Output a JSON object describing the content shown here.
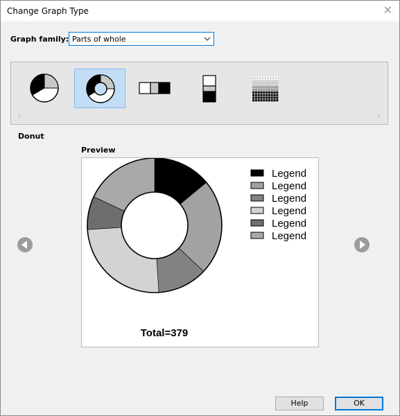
{
  "window": {
    "title": "Change Graph Type",
    "close_icon": "close-icon"
  },
  "graph_family": {
    "label": "Graph family:",
    "selected": "Parts of whole"
  },
  "gallery": {
    "items": [
      {
        "name": "pie",
        "icon": "pie-chart-icon",
        "selected": false
      },
      {
        "name": "donut",
        "icon": "donut-chart-icon",
        "selected": true
      },
      {
        "name": "stacked-bar",
        "icon": "stacked-bar-icon",
        "selected": false
      },
      {
        "name": "stacked-column",
        "icon": "stacked-column-icon",
        "selected": false
      },
      {
        "name": "waffle",
        "icon": "waffle-chart-icon",
        "selected": false
      }
    ],
    "scroll_left_icon": "chevron-left-icon",
    "scroll_right_icon": "chevron-right-icon"
  },
  "selected_type_name": "Donut",
  "preview": {
    "label": "Preview",
    "chart_data": {
      "type": "pie",
      "variant": "donut",
      "series": [
        {
          "name": "Legend",
          "value": 14,
          "color": "#000000"
        },
        {
          "name": "Legend",
          "value": 23,
          "color": "#a2a2a2"
        },
        {
          "name": "Legend",
          "value": 12,
          "color": "#828282"
        },
        {
          "name": "Legend",
          "value": 25,
          "color": "#d3d3d3"
        },
        {
          "name": "Legend",
          "value": 8,
          "color": "#6e6e6e"
        },
        {
          "name": "Legend",
          "value": 18,
          "color": "#a9a9a9"
        }
      ],
      "total_label": "Total=379",
      "legend_position": "top-right"
    }
  },
  "navigation": {
    "prev_icon": "arrow-left-circle-icon",
    "next_icon": "arrow-right-circle-icon"
  },
  "buttons": {
    "help": "Help",
    "ok": "OK"
  }
}
